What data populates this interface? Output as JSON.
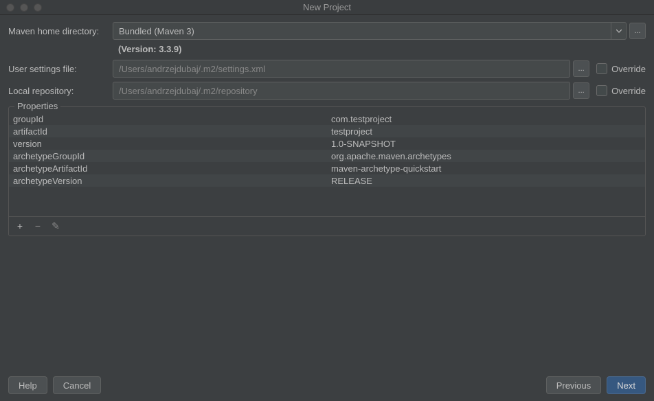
{
  "window": {
    "title": "New Project"
  },
  "form": {
    "mavenHome": {
      "label": "Maven home directory:",
      "value": "Bundled (Maven 3)"
    },
    "version": "(Version: 3.3.9)",
    "userSettings": {
      "label": "User settings file:",
      "value": "/Users/andrzejdubaj/.m2/settings.xml",
      "overrideLabel": "Override"
    },
    "localRepo": {
      "label": "Local repository:",
      "value": "/Users/andrzejdubaj/.m2/repository",
      "overrideLabel": "Override"
    },
    "browse": "..."
  },
  "properties": {
    "legend": "Properties",
    "rows": [
      {
        "key": "groupId",
        "val": "com.testproject"
      },
      {
        "key": "artifactId",
        "val": "testproject"
      },
      {
        "key": "version",
        "val": "1.0-SNAPSHOT"
      },
      {
        "key": "archetypeGroupId",
        "val": "org.apache.maven.archetypes"
      },
      {
        "key": "archetypeArtifactId",
        "val": "maven-archetype-quickstart"
      },
      {
        "key": "archetypeVersion",
        "val": "RELEASE"
      }
    ],
    "toolbar": {
      "add": "+",
      "remove": "−",
      "edit": "✎"
    }
  },
  "footer": {
    "help": "Help",
    "cancel": "Cancel",
    "previous": "Previous",
    "next": "Next"
  }
}
